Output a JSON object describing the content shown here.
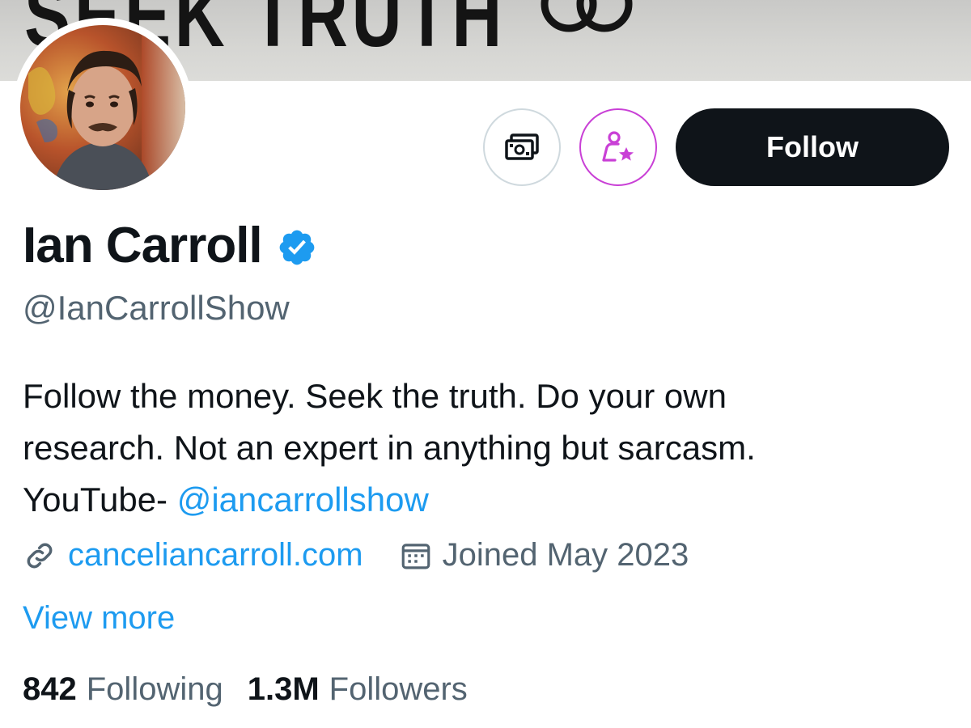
{
  "banner": {
    "text": "SEEK TRUTH"
  },
  "profile": {
    "display_name": "Ian Carroll",
    "handle": "@IanCarrollShow",
    "verified": true,
    "verified_icon": "verified-badge-icon",
    "bio": {
      "line1": "Follow the money. Seek the truth. Do your own",
      "line2": "research. Not an expert in anything but sarcasm.",
      "line3_prefix": "YouTube- ",
      "line3_mention": "@iancarrollshow"
    },
    "website": "canceliancarroll.com",
    "joined": "Joined May 2023",
    "view_more": "View more",
    "following_count": "842",
    "following_label": "Following",
    "followers_count": "1.3M",
    "followers_label": "Followers"
  },
  "actions": {
    "tip_icon": "money-icon",
    "subscribe_icon": "person-star-icon",
    "follow_label": "Follow"
  },
  "colors": {
    "accent": "#1d9bf0",
    "subscribe": "#c940d6",
    "text_primary": "#0f1419",
    "text_secondary": "#536471",
    "follow_bg": "#0f1419"
  }
}
